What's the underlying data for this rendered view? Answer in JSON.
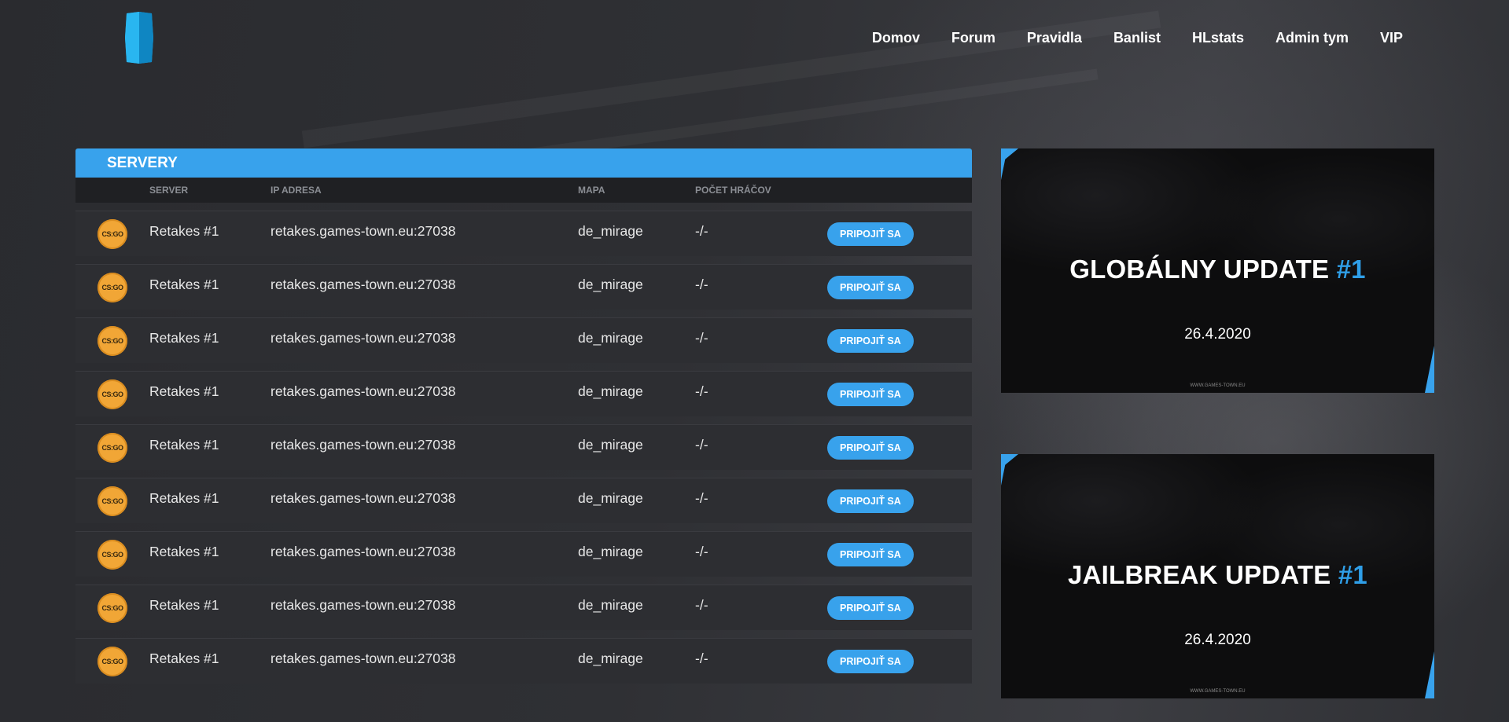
{
  "nav": {
    "items": [
      "Domov",
      "Forum",
      "Pravidla",
      "Banlist",
      "HLstats",
      "Admin tym",
      "VIP"
    ]
  },
  "servers": {
    "title": "SERVERY",
    "headers": {
      "server": "SERVER",
      "ip": "IP ADRESA",
      "map": "MAPA",
      "players": "POČET HRÁČOV"
    },
    "icon_label": "CS:GO",
    "rows": [
      {
        "name": "Retakes #1",
        "ip": "retakes.games-town.eu:27038",
        "map": "de_mirage",
        "players": "-/-",
        "action": "PRIPOJIŤ SA"
      },
      {
        "name": "Retakes #1",
        "ip": "retakes.games-town.eu:27038",
        "map": "de_mirage",
        "players": "-/-",
        "action": "PRIPOJIŤ SA"
      },
      {
        "name": "Retakes #1",
        "ip": "retakes.games-town.eu:27038",
        "map": "de_mirage",
        "players": "-/-",
        "action": "PRIPOJIŤ SA"
      },
      {
        "name": "Retakes #1",
        "ip": "retakes.games-town.eu:27038",
        "map": "de_mirage",
        "players": "-/-",
        "action": "PRIPOJIŤ SA"
      },
      {
        "name": "Retakes #1",
        "ip": "retakes.games-town.eu:27038",
        "map": "de_mirage",
        "players": "-/-",
        "action": "PRIPOJIŤ SA"
      },
      {
        "name": "Retakes #1",
        "ip": "retakes.games-town.eu:27038",
        "map": "de_mirage",
        "players": "-/-",
        "action": "PRIPOJIŤ SA"
      },
      {
        "name": "Retakes #1",
        "ip": "retakes.games-town.eu:27038",
        "map": "de_mirage",
        "players": "-/-",
        "action": "PRIPOJIŤ SA"
      },
      {
        "name": "Retakes #1",
        "ip": "retakes.games-town.eu:27038",
        "map": "de_mirage",
        "players": "-/-",
        "action": "PRIPOJIŤ SA"
      },
      {
        "name": "Retakes #1",
        "ip": "retakes.games-town.eu:27038",
        "map": "de_mirage",
        "players": "-/-",
        "action": "PRIPOJIŤ SA"
      }
    ]
  },
  "news": [
    {
      "title": "GLOBÁLNY UPDATE",
      "number": "#1",
      "date": "26.4.2020",
      "footer": "WWW.GAMES-TOWN.EU"
    },
    {
      "title": "JAILBREAK UPDATE",
      "number": "#1",
      "date": "26.4.2020",
      "footer": "WWW.GAMES-TOWN.EU"
    }
  ],
  "colors": {
    "accent": "#38a2ec",
    "icon": "#f1a636"
  },
  "icons": {
    "logo": "blue-hexagon-logo-icon",
    "server": "csgo-icon"
  }
}
